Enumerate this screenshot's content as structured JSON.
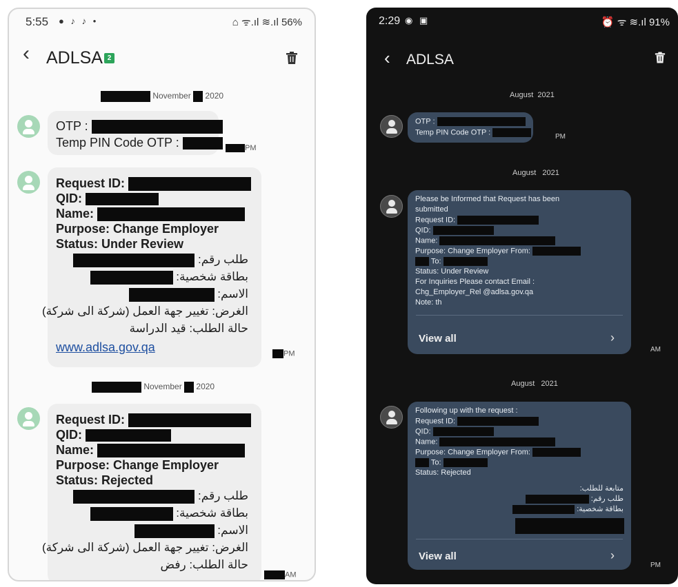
{
  "left": {
    "status": {
      "time": "5:55",
      "left_icons": "● ♪ ♪ •",
      "right_icons": "⌂ ᯤ.ıl ≋.ıl",
      "battery": "56%"
    },
    "header": {
      "title": "ADLSA",
      "sim_badge": "2"
    },
    "dates": [
      {
        "month": "November",
        "year": "2020"
      },
      {
        "month": "November",
        "year": "2020"
      }
    ],
    "msg1": {
      "otp": "OTP :",
      "temp_pin": "Temp PIN Code OTP :",
      "time": "PM"
    },
    "msg2": {
      "request_id": "Request ID:",
      "qid": "QID:",
      "name": "Name:",
      "purpose": "Purpose: Change Employer",
      "status": "Status: Under Review",
      "ar_request": "طلب رقم:",
      "ar_id": "بطاقة شخصية:",
      "ar_name": "الاسم:",
      "ar_purpose": "الغرض: تغيير جهة العمل (شركة الى شركة)",
      "ar_status": "حالة الطلب: قيد الدراسة",
      "link": "www.adlsa.gov.qa",
      "time": "PM"
    },
    "msg3": {
      "request_id": "Request ID:",
      "qid": "QID:",
      "name": "Name:",
      "purpose": "Purpose: Change Employer",
      "status": "Status: Rejected",
      "ar_request": "طلب رقم:",
      "ar_id": "بطاقة شخصية:",
      "ar_name": "الاسم:",
      "ar_purpose": "الغرض: تغيير جهة العمل (شركة الى شركة)",
      "ar_status": "حالة الطلب: رفض",
      "time": "AM"
    }
  },
  "right": {
    "status": {
      "time": "2:29",
      "left_icons": "◉ ▣",
      "right_icons": "⏰ ᯤ ≋.ıl",
      "battery": "91%"
    },
    "header": {
      "title": "ADLSA"
    },
    "dates": [
      {
        "month": "August",
        "year": "2021"
      },
      {
        "month": "August",
        "year": "2021"
      },
      {
        "month": "August",
        "year": "2021"
      }
    ],
    "msg1": {
      "otp": "OTP :",
      "temp_pin": "Temp PIN Code OTP :",
      "time": "PM"
    },
    "msg2": {
      "intro": "Please be Informed that Request has been",
      "intro2": "submitted",
      "request_id": "Request ID:",
      "qid": "QID:",
      "name": "Name:",
      "purpose": "Purpose: Change Employer From:",
      "to": "To:",
      "status": "Status: Under Review",
      "inquiries": "For Inquiries Please contact Email :",
      "email": "Chg_Employer_Rel @adlsa.gov.qa",
      "note": "Note: th",
      "view_all": "View all",
      "time": "AM"
    },
    "msg3": {
      "intro": "Following up with the request  :",
      "request_id": "Request ID:",
      "qid": "QID:",
      "name": "Name:",
      "purpose": "Purpose: Change Employer From:",
      "to": "To:",
      "status": "Status: Rejected",
      "ar_follow": "متابعة للطلب:",
      "ar_request": "طلب رقم:",
      "ar_id": "بطاقة شخصية:",
      "view_all": "View all",
      "time": "PM"
    }
  }
}
